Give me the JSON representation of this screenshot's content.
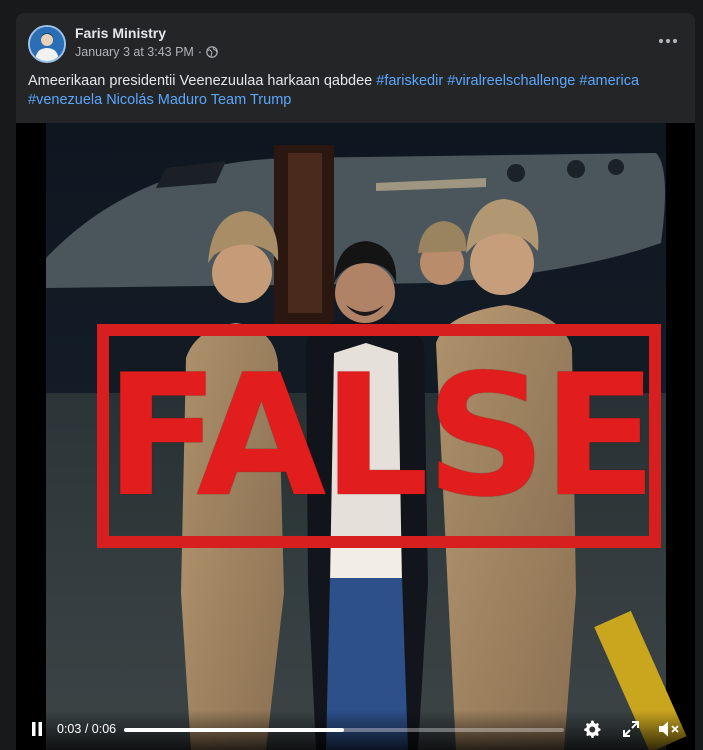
{
  "post": {
    "author": "Faris Ministry",
    "timestamp": "January 3 at 3:43 PM",
    "separator": "·",
    "privacy_icon": "globe-icon",
    "more_icon": "more-horizontal-icon",
    "caption": {
      "text": "Ameerikaan presidentii Veenezuulaa harkaan qabdee",
      "tags": [
        "#fariskedir",
        "#viralreelschallenge",
        "#america",
        "#venezuela",
        "Nicolás",
        "Maduro",
        "Team",
        "Trump"
      ]
    }
  },
  "video": {
    "stamp_text": "FALSE",
    "stamp_color": "#d81f1f",
    "current_time": "0:03",
    "duration": "0:06",
    "time_separator": "/",
    "progress_fraction": 0.5,
    "icons": {
      "play_pause": "pause-icon",
      "settings": "gear-icon",
      "fullscreen": "fullscreen-icon",
      "volume": "volume-muted-icon"
    }
  },
  "colors": {
    "background": "#18191a",
    "card": "#242526",
    "link": "#5aa7ff",
    "text": "#e4e6eb",
    "muted": "#b0b3b8"
  }
}
